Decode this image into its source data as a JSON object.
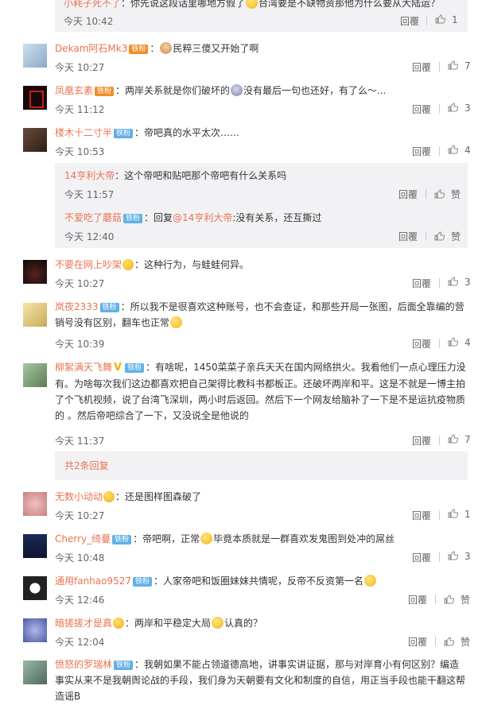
{
  "comments": [
    {
      "user": "小耗子死不了",
      "text": "：你先说这段话里哪地方假了",
      "text2": "台湾要是不缺物资那他为什么要从大陆运？",
      "time": "今天 10:42",
      "reply": "回覆",
      "likes": "1"
    },
    {
      "user": "Dekam阿石Mk3",
      "badge": "铁粉",
      "text": "民粹三傻又开始了啊",
      "time": "今天 10:27",
      "reply": "回覆",
      "likes": "7"
    },
    {
      "user": "凤凰玄素",
      "badge": "铁粉",
      "text": "：两岸关系就是你们破坏的",
      "text2": "没有最后一句也还好，有了么～...",
      "time": "今天 11:12",
      "reply": "回覆",
      "likes": "3"
    },
    {
      "user": "楼木十二寸半",
      "badge": "铁粉",
      "text": "：帝吧真的水平太次……",
      "time": "今天 10:53",
      "reply": "回覆",
      "likes": "4"
    },
    {
      "user": "不要在网上吵架",
      "badge": "",
      "text": "：这种行为，与蛙蛙何异。",
      "time": "今天 10:27",
      "reply": "回覆",
      "likes": "3"
    },
    {
      "user": "岚夜2333",
      "badge": "铁粉",
      "text": "：所以我不是很喜欢这种账号，也不会查证，和那些开局一张图，后面全靠编的营销号没有区别，翻车也正常",
      "time": "今天 10:39",
      "reply": "回覆",
      "likes": "4"
    },
    {
      "user": "柳絮满天飞舞",
      "badge": "铁粉",
      "text": "：有啥呢，1450菜菜子亲兵天天在国内网络拱火。我看他们一点心理压力没有。为啥每次我们这边都喜欢把自己架得比教科书都板正。还破坏两岸和平。这是不就是一博主拍了个飞机视频，说了台湾飞深圳，两小时后返回。然后下一个网友给脑补了一下是不是运抗疫物质的 。然后帝吧综合了一下，又没说全是他说的",
      "time": "今天 11:37",
      "reply": "回覆",
      "likes": "7"
    },
    {
      "user": "无数小动动",
      "badge": "",
      "text": "：还是图样图森破了",
      "time": "今天 10:27",
      "reply": "回覆",
      "likes": "1"
    },
    {
      "user": "Cherry_绮蔓",
      "badge": "铁粉",
      "text": "：帝吧啊，正常",
      "text2": "毕竟本质就是一群喜欢发鬼图到处冲的屌丝",
      "time": "今天 10:48",
      "reply": "回覆",
      "likes": "3"
    },
    {
      "user": "通用fanhao9527",
      "badge": "铁粉",
      "text": "：人家帝吧和饭圈妹妹共情呢，反帝不反资第一名",
      "time": "今天 12:46",
      "reply": "回覆",
      "likes": "赞"
    },
    {
      "user": "暗搓搓才是真",
      "badge": "",
      "text": "：两岸和平稳定大局",
      "text2": "认真的？",
      "time": "今天 12:04",
      "reply": "回覆",
      "likes": "赞"
    },
    {
      "user": "愤怒的罗瑞林",
      "badge": "铁粉",
      "text": "：我朝如果不能占领道德高地，讲事实讲证据，那与对岸育小有何区别？编造事实从来不是我朝舆论战的手段，我们身为天朝要有文化和制度的自信，用正当手段也能干翻这帮造谣B"
    }
  ],
  "subreplies": [
    {
      "user": "14亨利大帝",
      "text": "：这个帝吧和贴吧那个帝吧有什么关系吗",
      "time": "今天 11:57",
      "reply": "回覆",
      "likes": "赞"
    },
    {
      "user": "不爱吃了蘑菇",
      "badge": "铁粉",
      "text": "：回复",
      "mention": "@14亨利大帝",
      "text2": ":没有关系，还互撕过",
      "time": "今天 12:40",
      "reply": "回覆",
      "likes": "赞"
    }
  ],
  "more_replies": "共2条回复",
  "colors": {
    "name": "#eb7350",
    "link": "#eb7350",
    "muted": "#666666",
    "subbg": "#f2f2f5"
  }
}
